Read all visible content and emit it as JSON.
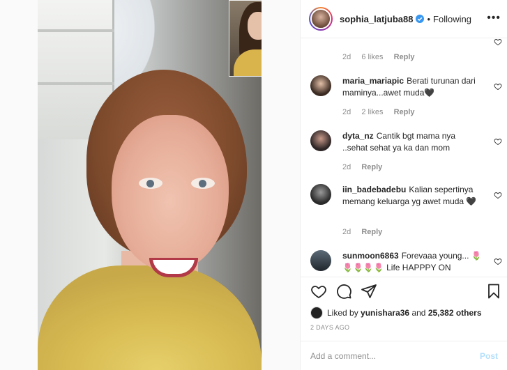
{
  "post": {
    "username": "sophia_latjuba88",
    "separator": "•",
    "follow_label": "Following",
    "more_icon": "more-horizontal-icon"
  },
  "comments": [
    {
      "user": "",
      "text": "",
      "age": "2d",
      "likes": "6 likes",
      "reply": "Reply"
    },
    {
      "user": "maria_mariapic",
      "text": "Berati turunan dari maminya...awet muda🖤",
      "age": "2d",
      "likes": "2 likes",
      "reply": "Reply"
    },
    {
      "user": "dyta_nz",
      "text": "Cantik bgt mama nya ..sehat sehat ya ka dan mom",
      "age": "2d",
      "likes": "",
      "reply": "Reply"
    },
    {
      "user": "iin_badebadebu",
      "text": "Kalian sepertinya memang keluarga yg awet muda 🖤",
      "age": "2d",
      "likes": "",
      "reply": "Reply"
    },
    {
      "user": "sunmoon6863",
      "text": "Forevaaa young... 🌷🌷🌷🌷🌷 Life HAPPPY ON",
      "age": "",
      "likes": "",
      "reply": ""
    }
  ],
  "likes": {
    "prefix": "Liked by",
    "user": "yunishara36",
    "and": "and",
    "count": "25,382 others"
  },
  "time_ago": "2 DAYS AGO",
  "add_comment": {
    "placeholder": "Add a comment...",
    "post_label": "Post"
  },
  "colors": {
    "verified": "#3897f0",
    "post_disabled": "#b2dffc",
    "meta": "#8e8e8e"
  }
}
